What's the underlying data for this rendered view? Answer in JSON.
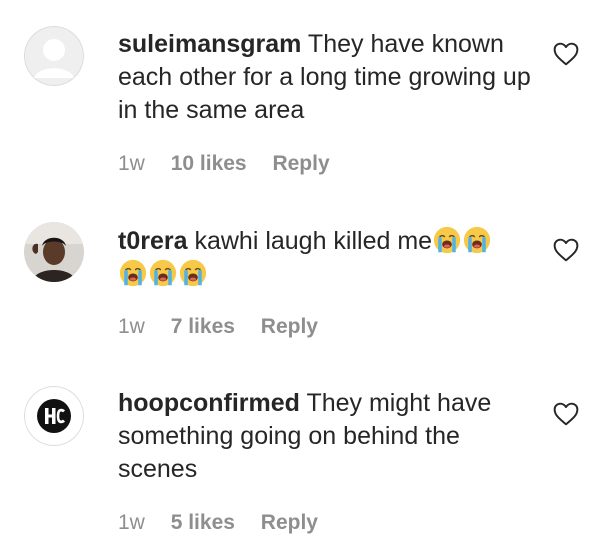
{
  "comments": [
    {
      "username": "suleimansgram",
      "text": "They have known each other for a long time growing up in the same area",
      "time": "1w",
      "likes": "10 likes",
      "reply": "Reply",
      "avatar": "default-avatar-icon"
    },
    {
      "username": "t0rera",
      "text": "kawhi laugh killed me",
      "emojis": [
        "😭",
        "😭",
        "😭",
        "😭",
        "😭"
      ],
      "time": "1w",
      "likes": "7 likes",
      "reply": "Reply",
      "avatar": "profile-photo"
    },
    {
      "username": "hoopconfirmed",
      "text": "They might have something going on behind the scenes",
      "time": "1w",
      "likes": "5 likes",
      "reply": "Reply",
      "avatar": "hc-logo-icon"
    }
  ],
  "icons": {
    "like": "heart-outline-icon",
    "emoji": "loudly-crying-face-icon"
  },
  "colors": {
    "text": "#262626",
    "meta": "#8e8e8e",
    "avatar_placeholder": "#dbdbdb",
    "emoji_face": "#f7c948",
    "emoji_tears": "#4fb3e8"
  }
}
